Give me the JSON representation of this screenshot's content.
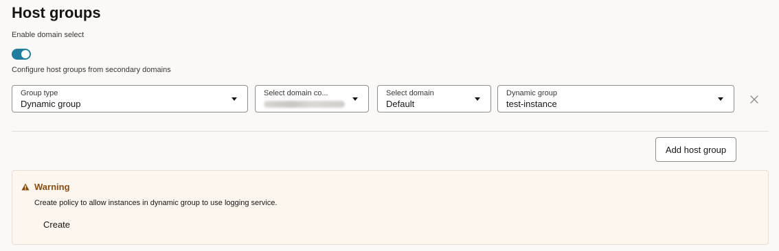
{
  "page": {
    "title": "Host groups",
    "toggle_label": "Enable domain select",
    "toggle_on": true,
    "toggle_help": "Configure host groups from secondary domains"
  },
  "row": {
    "group_type": {
      "label": "Group type",
      "value": "Dynamic group"
    },
    "domain_compartment": {
      "label": "Select domain co...",
      "value": ""
    },
    "domain": {
      "label": "Select domain",
      "value": "Default"
    },
    "dynamic_group": {
      "label": "Dynamic group",
      "value": "test-instance"
    }
  },
  "icons": {
    "caret": "chevron-down-icon",
    "remove": "close-icon",
    "warning": "warning-icon"
  },
  "add_button_label": "Add host group",
  "warning": {
    "title": "Warning",
    "text": "Create policy to allow instances in dynamic group to use logging service.",
    "link": "Create"
  },
  "colors": {
    "toggle_accent": "#227e9e",
    "warning_title": "#8a4b0d",
    "warning_bg": "#fdf6ef"
  }
}
